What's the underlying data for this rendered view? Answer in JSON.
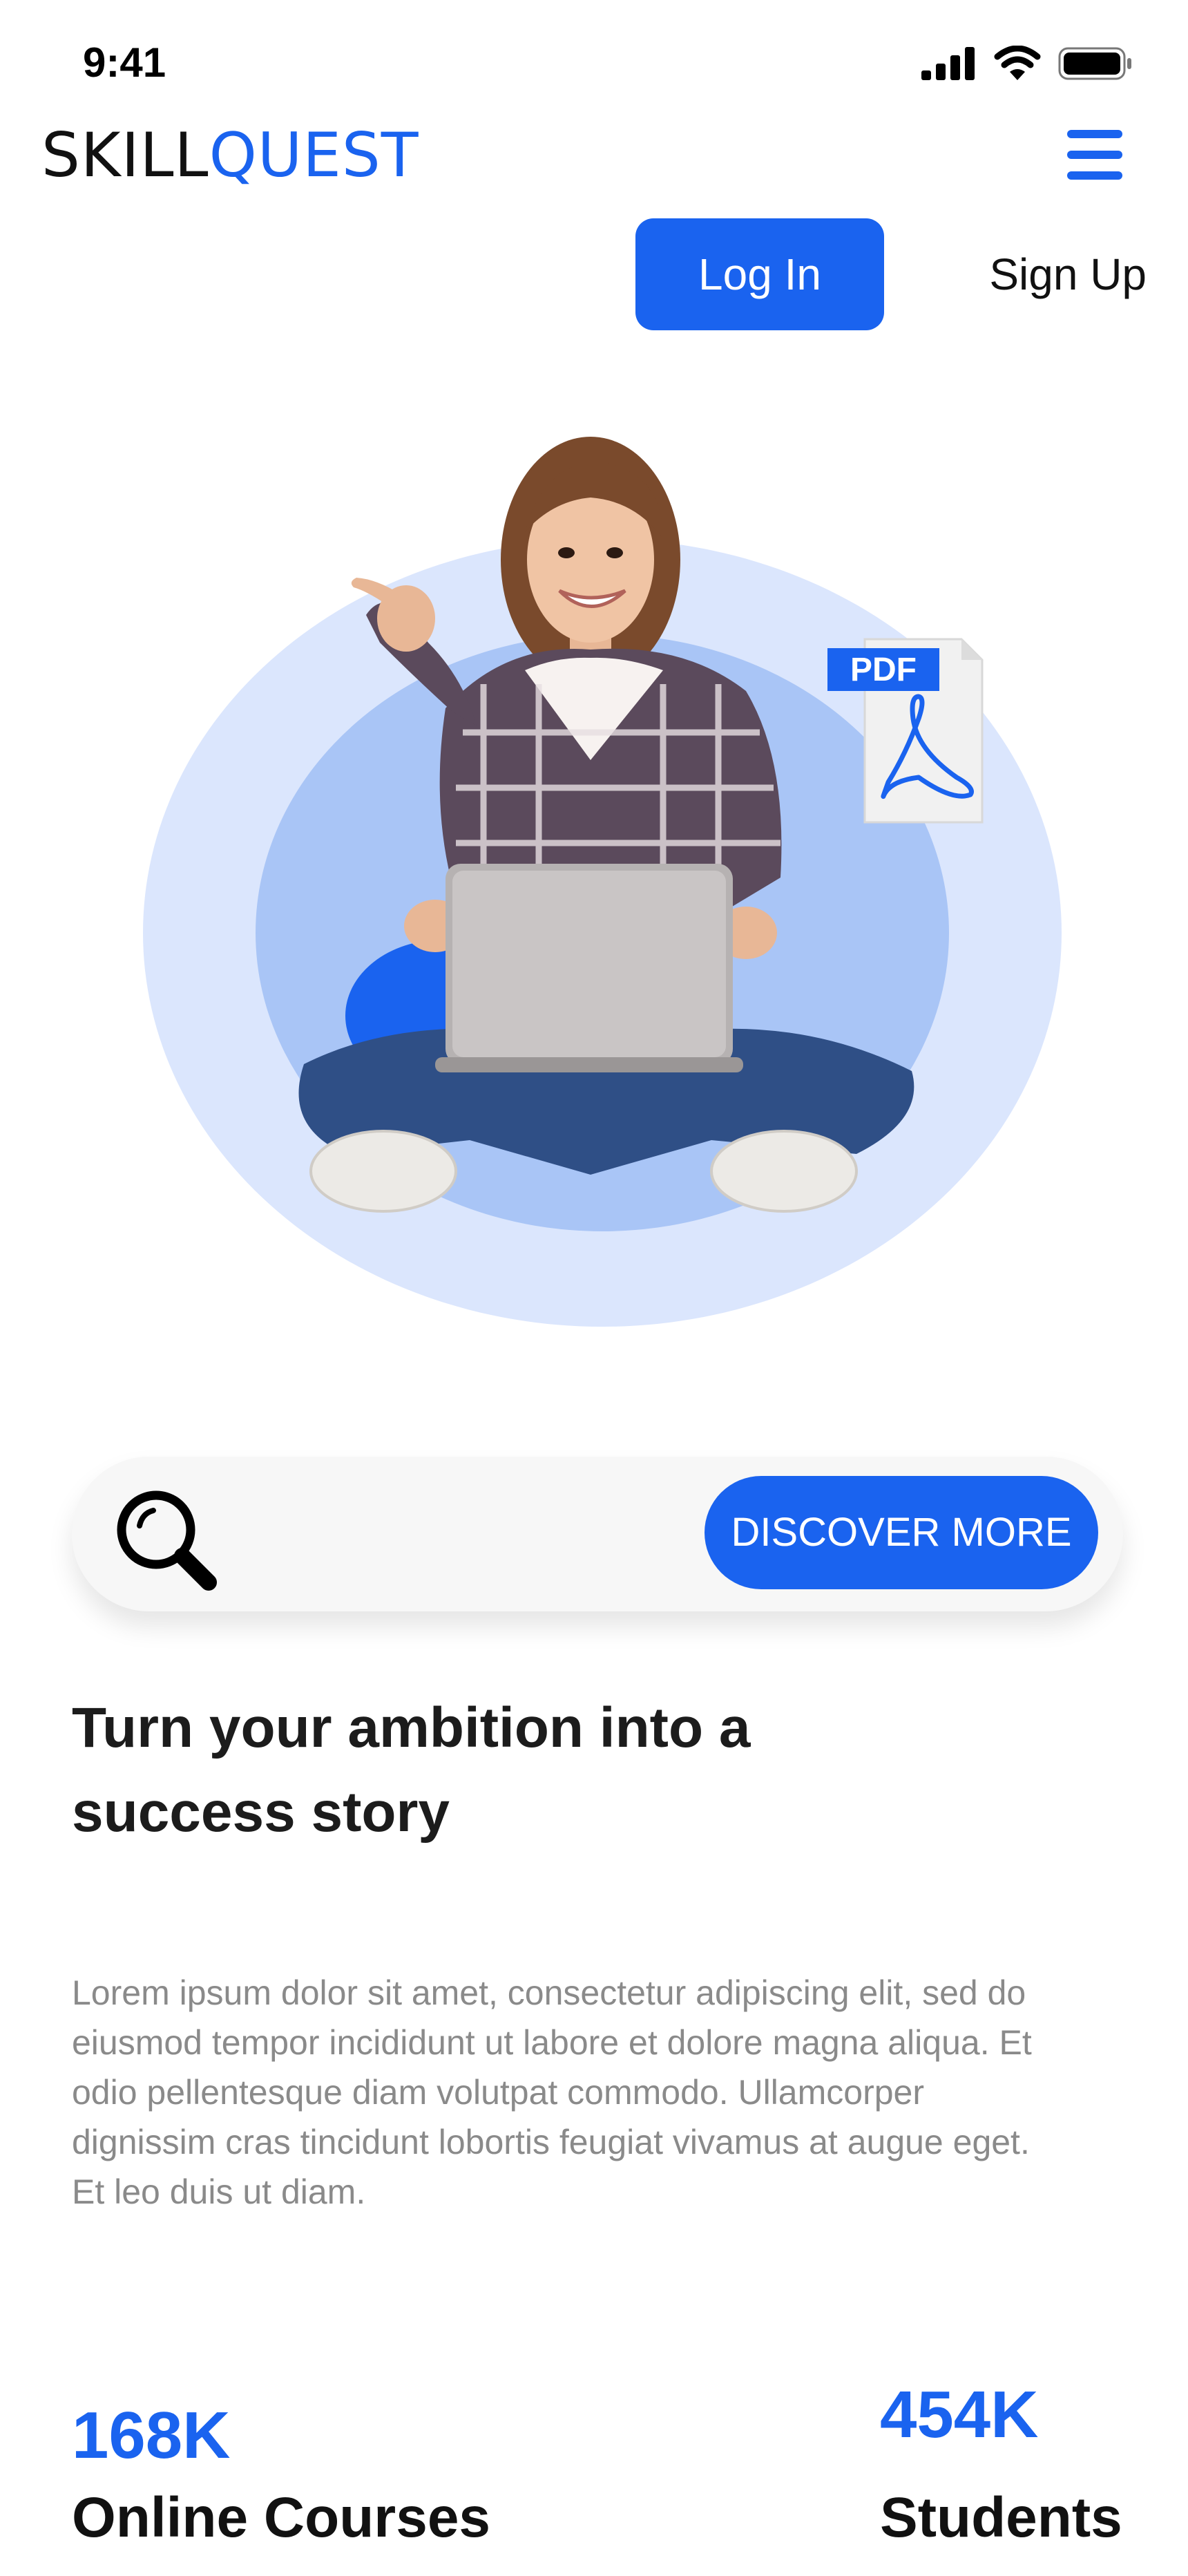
{
  "status_bar": {
    "time": "9:41"
  },
  "header": {
    "logo_part1": "SKILL",
    "logo_part2": "QUEST",
    "login_label": "Log In",
    "signup_label": "Sign Up"
  },
  "hero": {
    "image": "woman-with-laptop",
    "badge_label": "PDF"
  },
  "search": {
    "icon": "search-icon",
    "button_label": "DISCOVER MORE"
  },
  "content": {
    "headline_line1": "Turn your ambition into a",
    "headline_line2": "success story",
    "paragraph_lines": [
      "Lorem ipsum dolor sit amet, consectetur adipiscing elit, sed do",
      "eiusmod tempor incididunt ut labore et dolore magna aliqua. Et",
      "odio pellentesque diam volutpat commodo. Ullamcorper",
      "dignissim cras tincidunt lobortis feugiat vivamus at augue eget.",
      "Et leo duis ut diam."
    ]
  },
  "stats": [
    {
      "value": "168K",
      "label": "Online Courses"
    },
    {
      "value": "454K",
      "label": "Students"
    }
  ],
  "colors": {
    "accent": "#1a63ef",
    "circle_outer": "#dbe6fd",
    "circle_inner": "#a9c5f6",
    "text_dark": "#111111",
    "text_muted": "#8a8a8a"
  }
}
